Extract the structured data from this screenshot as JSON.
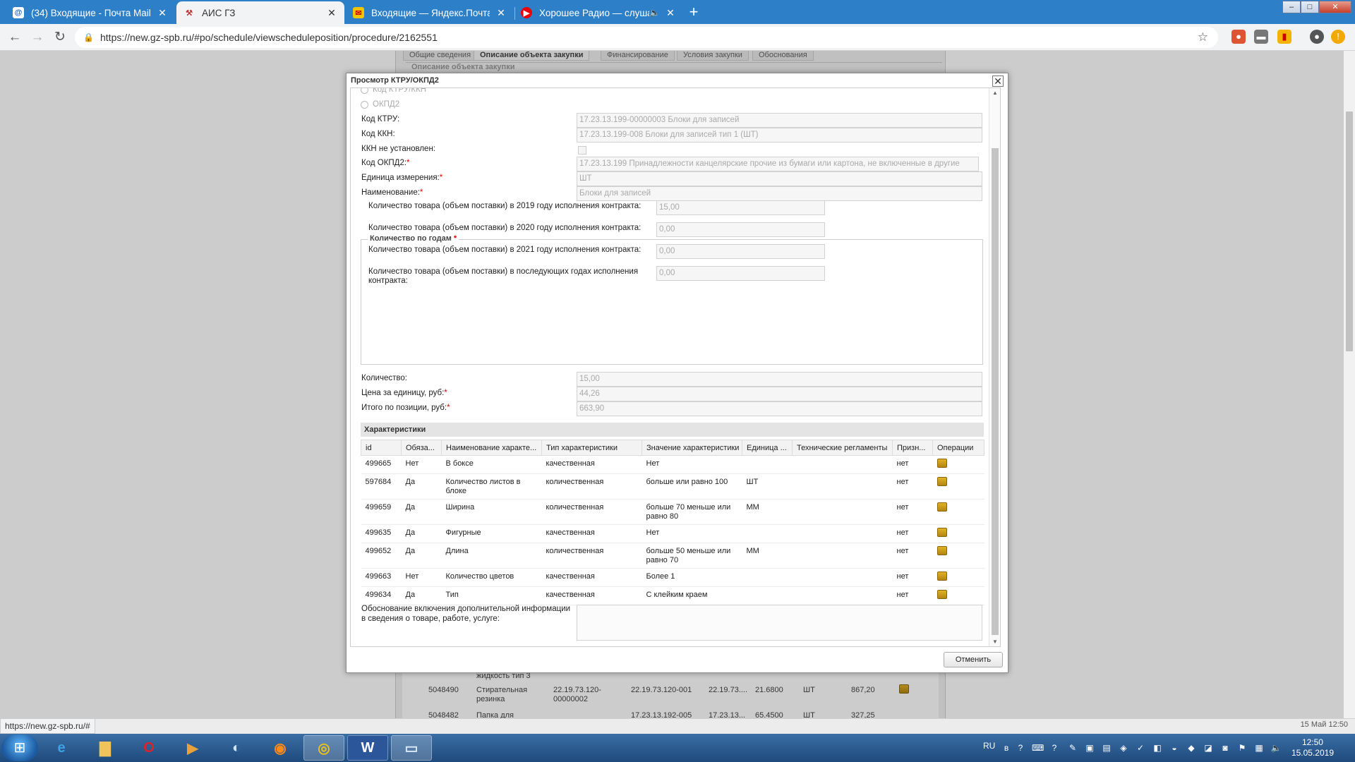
{
  "browser": {
    "tabs": [
      {
        "title": "(34) Входящие - Почта Mail.Ru",
        "close": "✕"
      },
      {
        "title": "АИС ГЗ",
        "close": "✕"
      },
      {
        "title": "Входящие — Яндекс.Почта",
        "close": "✕"
      },
      {
        "title": "Хорошее Радио — слушать",
        "close": "✕"
      }
    ],
    "new_tab": "+",
    "url": "https://new.gz-spb.ru/#po/schedule/viewscheduleposition/procedure/2162551",
    "window_buttons": [
      "–",
      "□",
      "✕"
    ]
  },
  "background": {
    "tabs": [
      "Общие сведения",
      "Описание объекта закупки",
      "Финансирование",
      "Условия закупки",
      "Обоснования"
    ],
    "section": "Описание объекта закупки",
    "rows": [
      {
        "c0": "",
        "c1": "жидкость тип 3",
        "c2": "",
        "c3": "",
        "c4": "",
        "c5": "",
        "c6": "",
        "c7": ""
      },
      {
        "c0": "5048490",
        "c1": "Стирательная",
        "c1b": "резинка",
        "c2": "22.19.73.120-",
        "c2b": "00000002",
        "c3": "22.19.73.120-001",
        "c4": "22.19.73....",
        "c5": "21.6800",
        "c6": "ШТ",
        "c7": "867,20"
      },
      {
        "c0": "5048482",
        "c1": "Папка для",
        "c2": "",
        "c3": "17.23.13.192-005",
        "c4": "17.23.13...",
        "c5": "65.4500",
        "c6": "ШТ",
        "c7": "327,25"
      }
    ]
  },
  "dialog": {
    "title": "Просмотр КТРУ/ОКПД2",
    "close": "✕",
    "radio1": "Код КТРУ/ККН",
    "radio2": "ОКПД2",
    "fields": {
      "ktru_label": "Код КТРУ:",
      "ktru_value": "17.23.13.199-00000003 Блоки для записей",
      "kkn_label": "Код ККН:",
      "kkn_value": "17.23.13.199-008 Блоки для записей тип 1 (ШТ)",
      "kkn_not_set_label": "ККН не установлен:",
      "okpd_label": "Код ОКПД2:",
      "okpd_value": "17.23.13.199 Принадлежности канцелярские прочие из бумаги или картона, не включенные в другие",
      "unit_label": "Единица измерения:",
      "unit_value": "ШТ",
      "name_label": "Наименование:",
      "name_value": "Блоки для записей",
      "required_mark": "*"
    },
    "years": {
      "legend": "Количество по годам",
      "items": [
        {
          "label": "Количество товара (объем поставки) в 2019 году исполнения контракта:",
          "value": "15,00"
        },
        {
          "label": "Количество товара (объем поставки) в 2020 году исполнения контракта:",
          "value": "0,00"
        },
        {
          "label": "Количество товара (объем поставки) в 2021 году исполнения контракта:",
          "value": "0,00"
        },
        {
          "label": "Количество товара (объем поставки) в последующих годах исполнения контракта:",
          "value": "0,00"
        }
      ]
    },
    "totals": {
      "qty_label": "Количество:",
      "qty_value": "15,00",
      "price_label": "Цена за единицу, руб:",
      "price_value": "44,26",
      "total_label": "Итого по позиции, руб:",
      "total_value": "663,90"
    },
    "characteristics": {
      "title": "Характеристики",
      "columns": [
        "id",
        "Обяза...",
        "Наименование характе...",
        "Тип характеристики",
        "Значение характеристики",
        "Единица ...",
        "Технические регламенты",
        "Призн...",
        "Операции"
      ],
      "rows": [
        {
          "id": "499665",
          "req": "Нет",
          "name": "В боксе",
          "type": "качественная",
          "value": "Нет",
          "unit": "",
          "reg": "",
          "flag": "нет"
        },
        {
          "id": "597684",
          "req": "Да",
          "name": "Количество листов в блоке",
          "type": "количественная",
          "value": "больше или равно 100",
          "unit": "ШТ",
          "reg": "",
          "flag": "нет"
        },
        {
          "id": "499659",
          "req": "Да",
          "name": "Ширина",
          "type": "количественная",
          "value": "больше 70 меньше или равно 80",
          "unit": "ММ",
          "reg": "",
          "flag": "нет"
        },
        {
          "id": "499635",
          "req": "Да",
          "name": "Фигурные",
          "type": "качественная",
          "value": "Нет",
          "unit": "",
          "reg": "",
          "flag": "нет"
        },
        {
          "id": "499652",
          "req": "Да",
          "name": "Длина",
          "type": "количественная",
          "value": "больше 50 меньше или равно 70",
          "unit": "ММ",
          "reg": "",
          "flag": "нет"
        },
        {
          "id": "499663",
          "req": "Нет",
          "name": "Количество цветов",
          "type": "качественная",
          "value": "Более 1",
          "unit": "",
          "reg": "",
          "flag": "нет"
        },
        {
          "id": "499634",
          "req": "Да",
          "name": "Тип",
          "type": "качественная",
          "value": "С клейким краем",
          "unit": "",
          "reg": "",
          "flag": "нет"
        }
      ]
    },
    "justification_label": "Обоснование включения дополнительной информации в сведения о товаре, работе, услуге:",
    "cancel": "Отменить"
  },
  "status": {
    "url": "https://new.gz-spb.ru/#",
    "page_date": "15 Май 12:50"
  },
  "taskbar": {
    "lang": "RU",
    "time": "12:50",
    "date": "15.05.2019",
    "word_label": "W"
  }
}
